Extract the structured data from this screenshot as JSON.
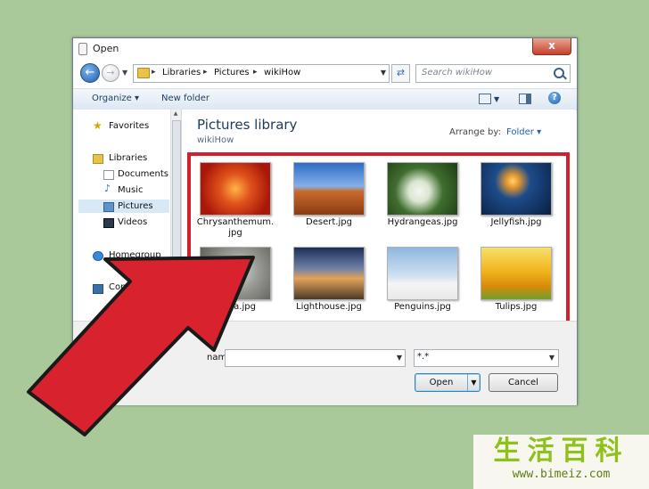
{
  "window": {
    "title": "Open",
    "close_label": "x"
  },
  "address": {
    "crumbs": [
      "Libraries",
      "Pictures",
      "wikiHow"
    ],
    "separator": "▸",
    "search_placeholder": "Search wikiHow"
  },
  "toolbar": {
    "organize_label": "Organize ▾",
    "new_folder_label": "New folder",
    "help_label": "?"
  },
  "sidebar": {
    "favorites": "Favorites",
    "libraries": "Libraries",
    "documents": "Documents",
    "music": "Music",
    "pictures": "Pictures",
    "videos": "Videos",
    "homegroup": "Homegroup",
    "computer": "Computer"
  },
  "library": {
    "title": "Pictures library",
    "subtitle": "wikiHow",
    "arrange_label": "Arrange by:",
    "arrange_value": "Folder"
  },
  "files": [
    {
      "name": "Chrysanthemum.\njpg"
    },
    {
      "name": "Desert.jpg"
    },
    {
      "name": "Hydrangeas.jpg"
    },
    {
      "name": "Jellyfish.jpg"
    },
    {
      "name": "Koala.jpg"
    },
    {
      "name": "Lighthouse.jpg"
    },
    {
      "name": "Penguins.jpg"
    },
    {
      "name": "Tulips.jpg"
    }
  ],
  "bottom": {
    "filename_label": "name:",
    "filename_value": "",
    "filter_value": "*.*",
    "open_label": "Open",
    "cancel_label": "Cancel"
  },
  "watermark": {
    "chars": "生活百科",
    "url": "www.bimeiz.com"
  },
  "colors": {
    "highlight_border": "#d2202f",
    "arrow_fill": "#d8232f",
    "background": "#a9c99a"
  }
}
